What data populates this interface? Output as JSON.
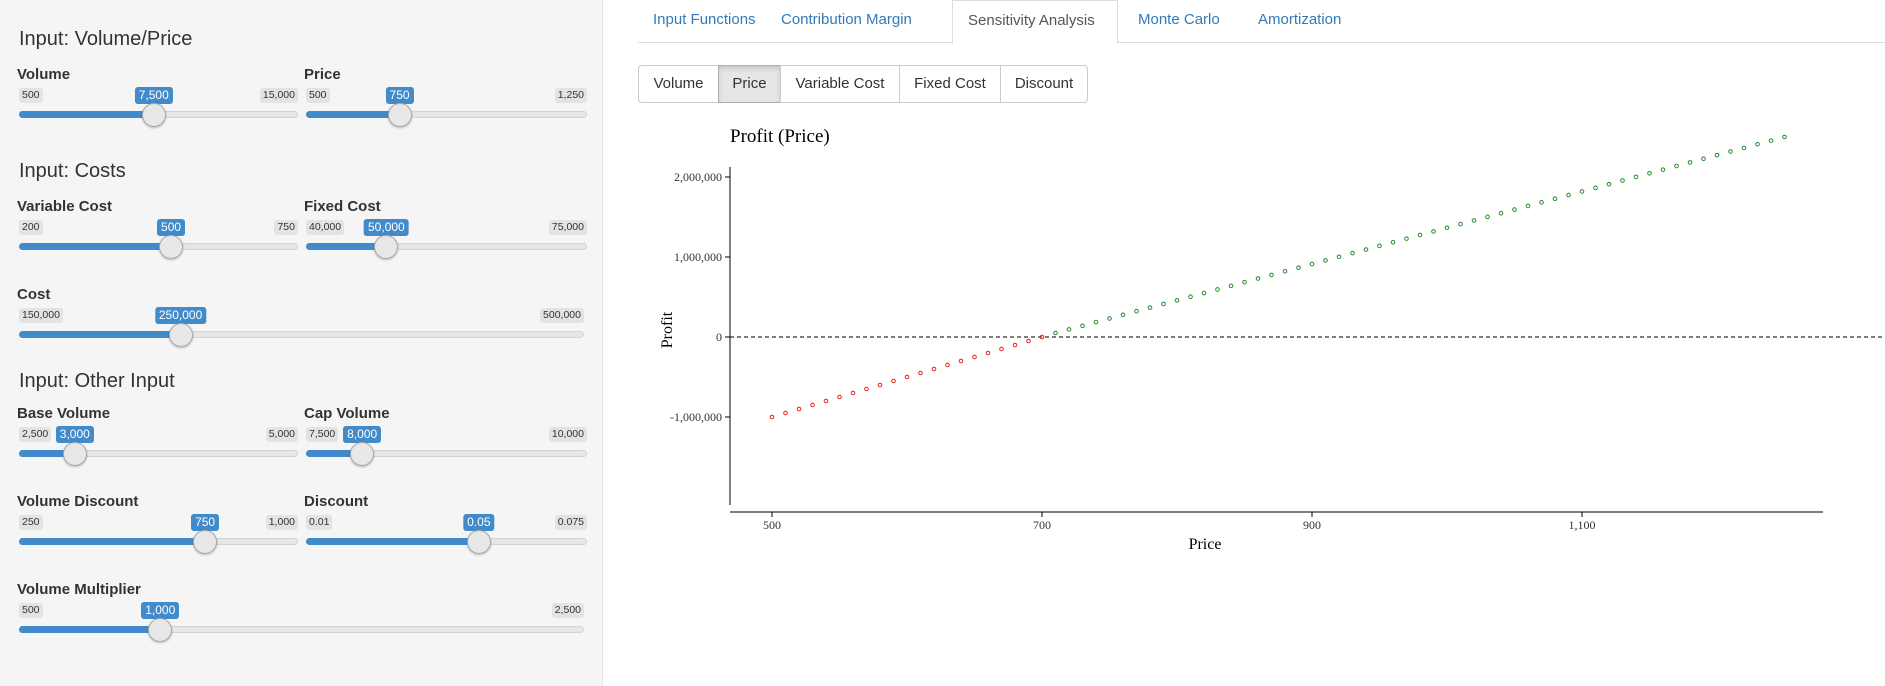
{
  "sidebar": {
    "sections": [
      {
        "title": "Input: Volume/Price"
      },
      {
        "title": "Input: Costs"
      },
      {
        "title": "Input: Other Input"
      }
    ],
    "sliders": [
      {
        "label": "Volume",
        "min_label": "500",
        "max_label": "15,000",
        "value_label": "7,500",
        "level": 0.483
      },
      {
        "label": "Price",
        "min_label": "500",
        "max_label": "1,250",
        "value_label": "750",
        "level": 0.333
      },
      {
        "label": "Variable Cost",
        "min_label": "200",
        "max_label": "750",
        "value_label": "500",
        "level": 0.545
      },
      {
        "label": "Fixed Cost",
        "min_label": "40,000",
        "max_label": "75,000",
        "value_label": "50,000",
        "level": 0.286
      },
      {
        "label": "Cost",
        "min_label": "150,000",
        "max_label": "500,000",
        "value_label": "250,000",
        "level": 0.286
      },
      {
        "label": "Base Volume",
        "min_label": "2,500",
        "max_label": "5,000",
        "value_label": "3,000",
        "level": 0.2
      },
      {
        "label": "Cap Volume",
        "min_label": "7,500",
        "max_label": "10,000",
        "value_label": "8,000",
        "level": 0.2
      },
      {
        "label": "Volume Discount",
        "min_label": "250",
        "max_label": "1,000",
        "value_label": "750",
        "level": 0.667
      },
      {
        "label": "Discount",
        "min_label": "0.01",
        "max_label": "0.075",
        "value_label": "0.05",
        "level": 0.615
      },
      {
        "label": "Volume Multiplier",
        "min_label": "500",
        "max_label": "2,500",
        "value_label": "1,000",
        "level": 0.25
      }
    ]
  },
  "tabs": [
    {
      "label": "Input Functions",
      "active": false
    },
    {
      "label": "Contribution Margin",
      "active": false
    },
    {
      "label": "Sensitivity Analysis",
      "active": true
    },
    {
      "label": "Monte Carlo",
      "active": false
    },
    {
      "label": "Amortization",
      "active": false
    }
  ],
  "sensitivity_buttons": [
    {
      "label": "Volume",
      "active": false
    },
    {
      "label": "Price",
      "active": true
    },
    {
      "label": "Variable Cost",
      "active": false
    },
    {
      "label": "Fixed Cost",
      "active": false
    },
    {
      "label": "Discount",
      "active": false
    }
  ],
  "colors": {
    "accent": "#428bca",
    "link": "#337ab7",
    "loss": "#e8221d",
    "profit": "#238b2d"
  },
  "chart_data": {
    "type": "scatter",
    "title": "Profit (Price)",
    "xlabel": "Price",
    "ylabel": "Profit",
    "xlim": [
      500,
      1250
    ],
    "ylim": [
      -1000000,
      2500000
    ],
    "x_ticks": [
      500,
      700,
      900,
      1100
    ],
    "x_tick_labels": [
      "500",
      "700",
      "900",
      "1,100"
    ],
    "y_ticks": [
      -1000000,
      0,
      1000000,
      2000000
    ],
    "y_tick_labels": [
      "-1,000,000",
      "0",
      "1,000,000",
      "2,000,000"
    ],
    "reference_line": {
      "y": 0,
      "style": "dashed"
    },
    "series": [
      {
        "color": "#e8221d",
        "x_start": 500,
        "x_end": 700,
        "x_step": 10,
        "y_start": -1000000,
        "y_end": 0
      },
      {
        "color": "#238b2d",
        "x_start": 710,
        "x_end": 1250,
        "x_step": 10,
        "y_start": 50000,
        "y_end": 2500000
      }
    ]
  }
}
